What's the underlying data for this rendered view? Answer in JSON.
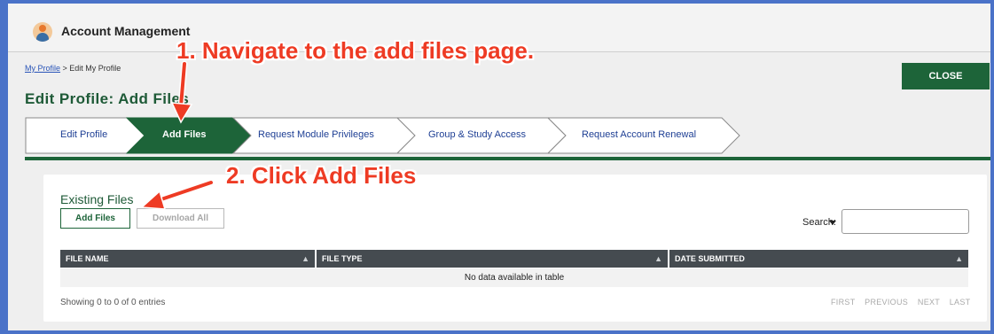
{
  "app": {
    "title": "Account Management",
    "icon": "user-icon"
  },
  "breadcrumb": {
    "link": "My Profile",
    "separator": " > ",
    "current": "Edit My Profile"
  },
  "page_title": "Edit Profile: Add Files",
  "close_label": "CLOSE",
  "steps": [
    {
      "label": "Edit Profile",
      "active": false
    },
    {
      "label": "Add Files",
      "active": true
    },
    {
      "label": "Request Module Privileges",
      "active": false
    },
    {
      "label": "Group & Study Access",
      "active": false
    },
    {
      "label": "Request Account Renewal",
      "active": false
    }
  ],
  "files_panel": {
    "title": "Existing Files",
    "add_label": "Add Files",
    "download_label": "Download All",
    "search_label": "Search:",
    "columns": [
      "FILE NAME",
      "FILE TYPE",
      "DATE SUBMITTED"
    ],
    "empty_message": "No data available in table",
    "info": "Showing 0 to 0 of 0 entries",
    "pager": [
      "FIRST",
      "PREVIOUS",
      "NEXT",
      "LAST"
    ]
  },
  "annotations": {
    "step1": "1. Navigate to the add files page.",
    "step2": "2. Click Add Files",
    "color": "#ee3b24"
  },
  "colors": {
    "brand_green": "#1d6439",
    "link_blue": "#1e3f94",
    "frame_blue": "#4a72c8"
  }
}
